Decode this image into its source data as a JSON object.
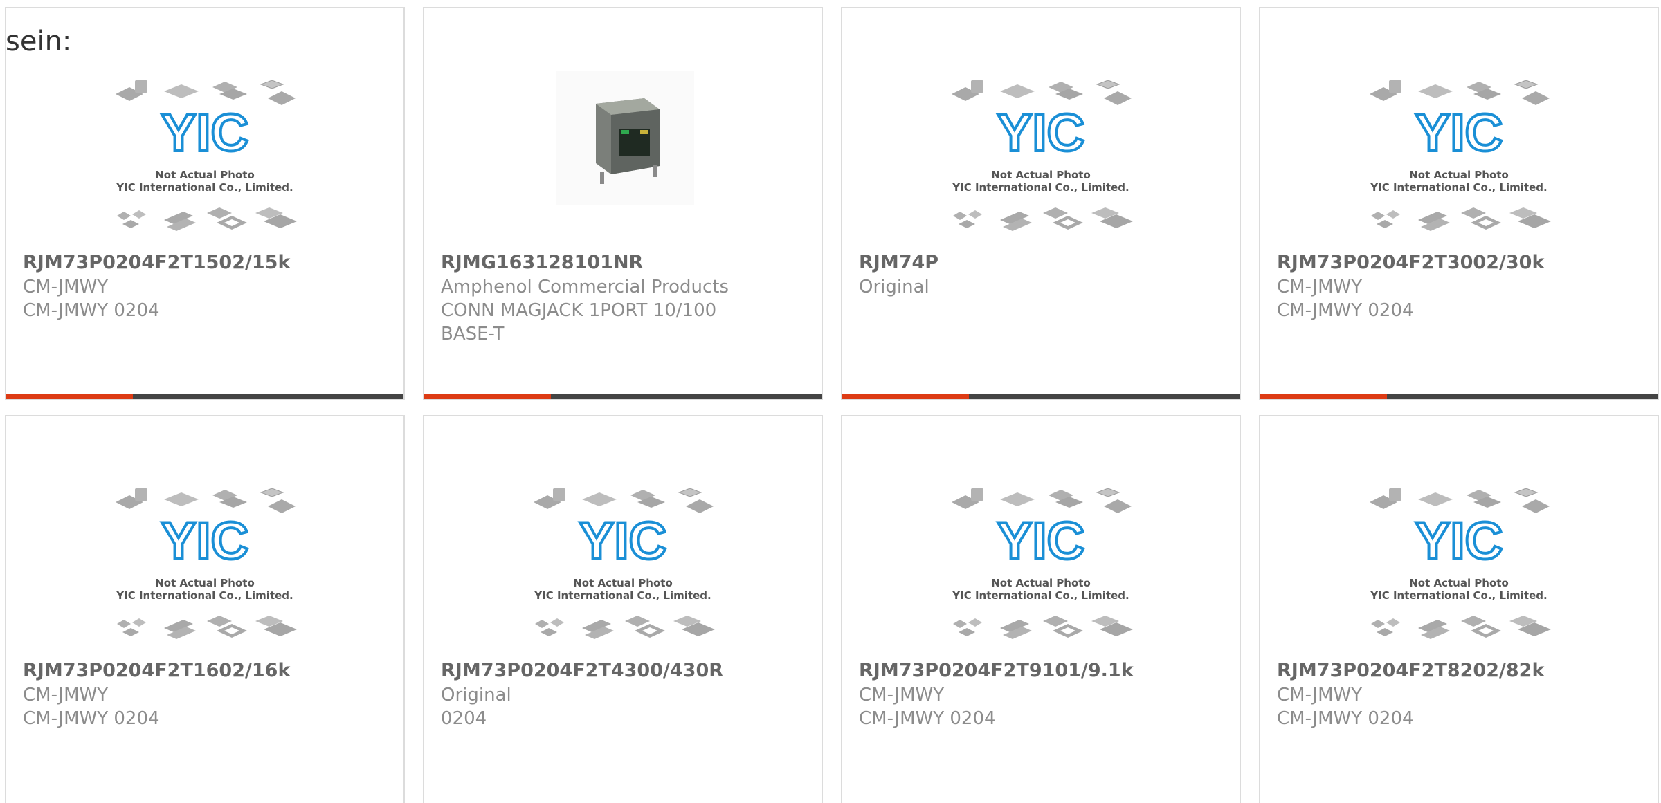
{
  "intro_text": "sein:",
  "placeholder_photo": {
    "line1": "Not Actual Photo",
    "line2": "YIC International Co., Limited.",
    "logo_text": "YIC"
  },
  "colors": {
    "accent": "#dd3b14",
    "bar": "#444444",
    "logo": "#1a8fd6"
  },
  "products": [
    {
      "title": "RJM73P0204F2T1502/15k",
      "line1": "CM-JMWY",
      "line2": "CM-JMWY 0204",
      "line3": "",
      "image": "placeholder"
    },
    {
      "title": "RJMG163128101NR",
      "line1": "Amphenol Commercial Products",
      "line2": "CONN MAGJACK 1PORT 10/100",
      "line3": "BASE-T",
      "image": "rj45-jack-photo"
    },
    {
      "title": "RJM74P",
      "line1": "Original",
      "line2": "",
      "line3": "",
      "image": "placeholder"
    },
    {
      "title": "RJM73P0204F2T3002/30k",
      "line1": "CM-JMWY",
      "line2": "CM-JMWY 0204",
      "line3": "",
      "image": "placeholder"
    },
    {
      "title": "RJM73P0204F2T1602/16k",
      "line1": "CM-JMWY",
      "line2": "CM-JMWY 0204",
      "line3": "",
      "image": "placeholder"
    },
    {
      "title": "RJM73P0204F2T4300/430R",
      "line1": "Original",
      "line2": "0204",
      "line3": "",
      "image": "placeholder"
    },
    {
      "title": "RJM73P0204F2T9101/9.1k",
      "line1": "CM-JMWY",
      "line2": "CM-JMWY 0204",
      "line3": "",
      "image": "placeholder"
    },
    {
      "title": "RJM73P0204F2T8202/82k",
      "line1": "CM-JMWY",
      "line2": "CM-JMWY 0204",
      "line3": "",
      "image": "placeholder"
    }
  ]
}
